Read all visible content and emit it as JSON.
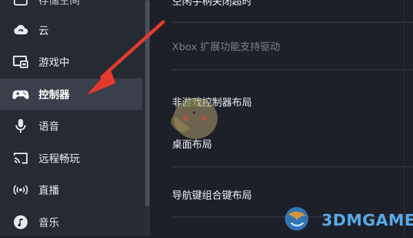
{
  "sidebar": {
    "items": [
      {
        "label": "存储空间",
        "icon": "storage-icon"
      },
      {
        "label": "云",
        "icon": "cloud-sync-icon"
      },
      {
        "label": "游戏中",
        "icon": "in-game-overlay-icon"
      },
      {
        "label": "控制器",
        "icon": "gamepad-icon",
        "active": true
      },
      {
        "label": "语音",
        "icon": "microphone-icon"
      },
      {
        "label": "远程畅玩",
        "icon": "cast-screen-icon"
      },
      {
        "label": "直播",
        "icon": "broadcast-icon"
      },
      {
        "label": "音乐",
        "icon": "music-note-icon"
      }
    ]
  },
  "main": {
    "rows": [
      {
        "label": "空闲手柄关闭超时"
      },
      {
        "label": "Xbox 扩展功能支持驱动",
        "disabled": true
      },
      {
        "label": "非游戏控制器布局"
      },
      {
        "label": "桌面布局"
      },
      {
        "label": "导航键组合键布局"
      }
    ]
  },
  "watermark": {
    "brand_text": "3DMGAME"
  },
  "colors": {
    "sidebar_bg": "#262a33",
    "main_bg": "#1d2029",
    "active_bg": "#3a3f4b",
    "annotation_arrow": "#e23b2e",
    "brand_blue": "#5aa8e6"
  }
}
